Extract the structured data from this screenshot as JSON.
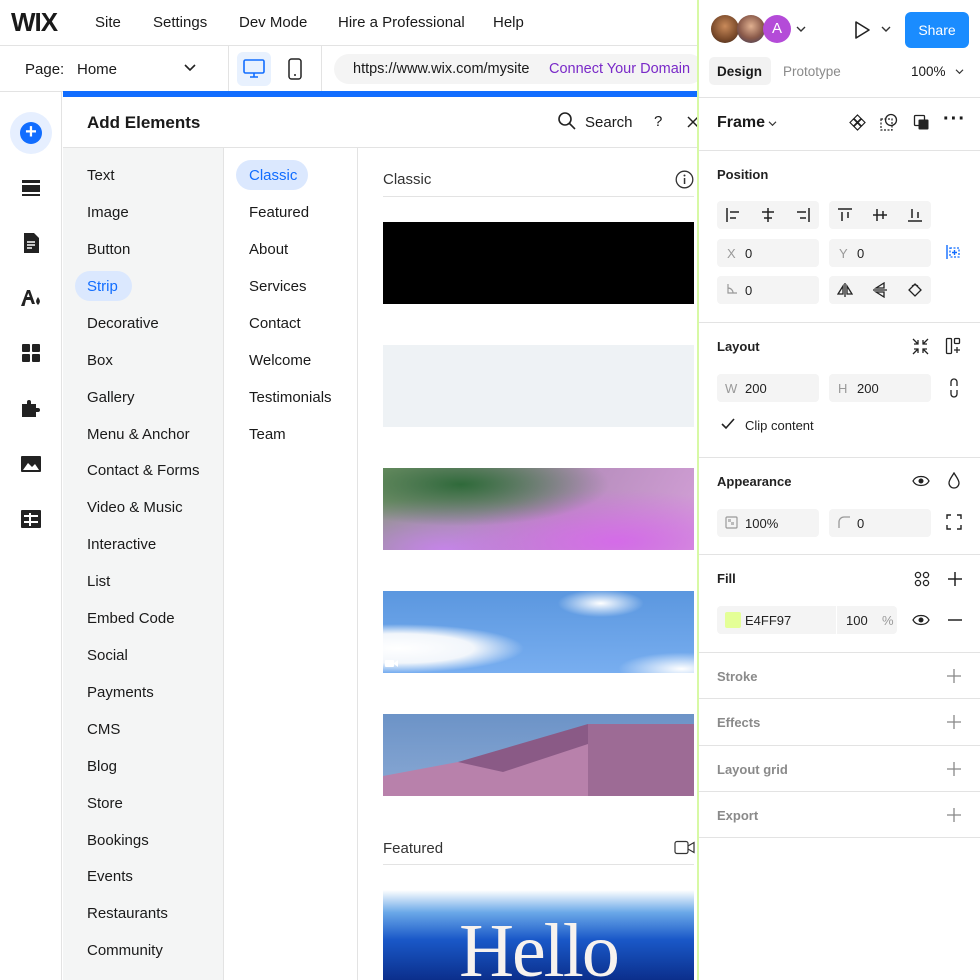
{
  "topbar": {
    "logo": "WIX",
    "menu": [
      "Site",
      "Settings",
      "Dev Mode",
      "Hire a Professional",
      "Help"
    ]
  },
  "pagebar": {
    "page_label": "Page:",
    "page_value": "Home",
    "url": "https://www.wix.com/mysite",
    "connect": "Connect Your Domain"
  },
  "add_panel": {
    "title": "Add Elements",
    "search": "Search",
    "help": "?",
    "categories": [
      "Text",
      "Image",
      "Button",
      "Strip",
      "Decorative",
      "Box",
      "Gallery",
      "Menu & Anchor",
      "Contact & Forms",
      "Video & Music",
      "Interactive",
      "List",
      "Embed Code",
      "Social",
      "Payments",
      "CMS",
      "Blog",
      "Store",
      "Bookings",
      "Events",
      "Restaurants",
      "Community"
    ],
    "selected_category": "Strip",
    "subcategories": [
      "Classic",
      "Featured",
      "About",
      "Services",
      "Contact",
      "Welcome",
      "Testimonials",
      "Team"
    ],
    "selected_subcategory": "Classic",
    "section_classic": "Classic",
    "section_featured": "Featured",
    "featured_thumb_text": "Hello"
  },
  "right_panel": {
    "share": "Share",
    "avatar_letter": "A",
    "tab_design": "Design",
    "tab_prototype": "Prototype",
    "zoom": "100%",
    "frame": "Frame",
    "position_title": "Position",
    "x_label": "X",
    "x_value": "0",
    "y_label": "Y",
    "y_value": "0",
    "rotation_value": "0",
    "layout_title": "Layout",
    "w_label": "W",
    "w_value": "200",
    "h_label": "H",
    "h_value": "200",
    "clip_content": "Clip content",
    "appearance_title": "Appearance",
    "opacity_value": "100%",
    "radius_value": "0",
    "fill_title": "Fill",
    "fill_hex": "E4FF97",
    "fill_opacity": "100",
    "fill_pct": "%",
    "stroke_title": "Stroke",
    "effects_title": "Effects",
    "layout_grid_title": "Layout grid",
    "export_title": "Export"
  },
  "colors": {
    "accent": "#116dff",
    "connect": "#7a2ac8",
    "fill_swatch": "#E4FF97"
  }
}
